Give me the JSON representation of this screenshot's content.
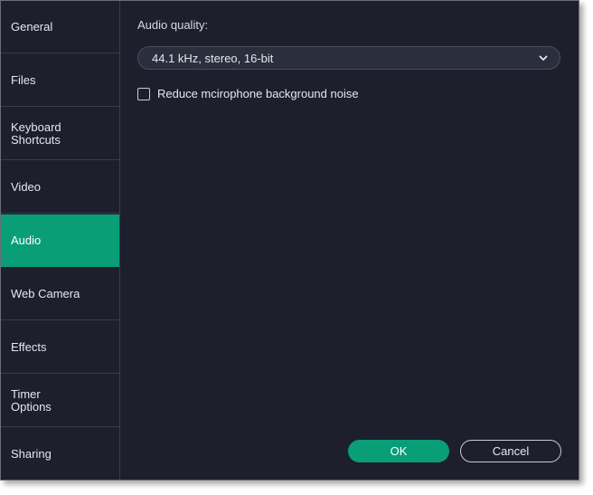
{
  "sidebar": {
    "items": [
      {
        "label": "General"
      },
      {
        "label": "Files"
      },
      {
        "label": "Keyboard\nShortcuts"
      },
      {
        "label": "Video"
      },
      {
        "label": "Audio"
      },
      {
        "label": "Web Camera"
      },
      {
        "label": "Effects"
      },
      {
        "label": "Timer\nOptions"
      },
      {
        "label": "Sharing"
      }
    ],
    "active": "Audio"
  },
  "audio": {
    "quality_label": "Audio quality:",
    "quality_value": "44.1 kHz, stereo, 16-bit",
    "noise_reduction_label": "Reduce mcirophone background noise",
    "noise_reduction_checked": false
  },
  "footer": {
    "ok_label": "OK",
    "cancel_label": "Cancel"
  },
  "colors": {
    "accent": "#0a9e77",
    "background": "#1d1f2d"
  }
}
